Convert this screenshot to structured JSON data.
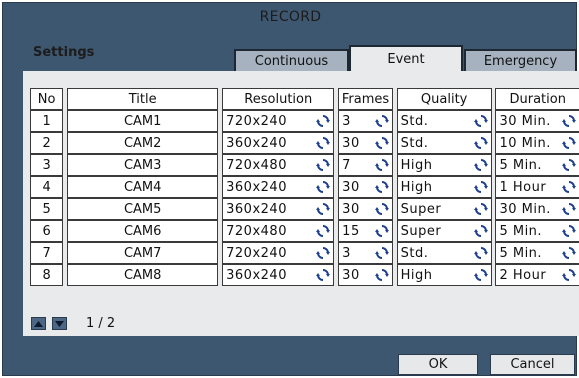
{
  "window": {
    "title": "RECORD"
  },
  "settings_label": "Settings",
  "tabs": [
    {
      "label": "Continuous",
      "active": false
    },
    {
      "label": "Event",
      "active": true
    },
    {
      "label": "Emergency",
      "active": false
    }
  ],
  "table": {
    "headers": [
      "No",
      "Title",
      "Resolution",
      "Frames",
      "Quality",
      "Duration"
    ],
    "rows": [
      {
        "no": "1",
        "title": "CAM1",
        "resolution": "720x240",
        "frames": "3",
        "quality": "Std.",
        "duration": "30 Min."
      },
      {
        "no": "2",
        "title": "CAM2",
        "resolution": "360x240",
        "frames": "30",
        "quality": "Std.",
        "duration": "10 Min."
      },
      {
        "no": "3",
        "title": "CAM3",
        "resolution": "720x480",
        "frames": "7",
        "quality": "High",
        "duration": "5 Min."
      },
      {
        "no": "4",
        "title": "CAM4",
        "resolution": "360x240",
        "frames": "30",
        "quality": "High",
        "duration": "1 Hour"
      },
      {
        "no": "5",
        "title": "CAM5",
        "resolution": "360x240",
        "frames": "30",
        "quality": "Super",
        "duration": "30 Min."
      },
      {
        "no": "6",
        "title": "CAM6",
        "resolution": "720x480",
        "frames": "15",
        "quality": "Super",
        "duration": "5 Min."
      },
      {
        "no": "7",
        "title": "CAM7",
        "resolution": "720x240",
        "frames": "3",
        "quality": "Std.",
        "duration": "5 Min."
      },
      {
        "no": "8",
        "title": "CAM8",
        "resolution": "360x240",
        "frames": "30",
        "quality": "High",
        "duration": "2 Hour"
      }
    ]
  },
  "pagination": {
    "page": "1 / 2"
  },
  "buttons": {
    "ok": "OK",
    "cancel": "Cancel"
  },
  "icons": {
    "cycle": "cycle-icon",
    "up": "arrow-up-icon",
    "down": "arrow-down-icon"
  },
  "colors": {
    "window_bg": "#3e5770",
    "panel_bg": "#e9eaec",
    "tab_inactive": "#a6b2c0",
    "cycle_icon": "#1c3f8f"
  }
}
